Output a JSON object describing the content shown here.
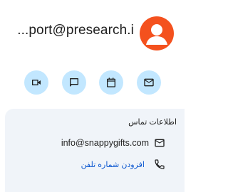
{
  "contact": {
    "display_email_truncated": "...port@presearch.i",
    "avatar_color": "#f4511e"
  },
  "actions": [
    {
      "icon": "video-call-icon"
    },
    {
      "icon": "chat-icon"
    },
    {
      "icon": "calendar-icon"
    },
    {
      "icon": "mail-icon"
    }
  ],
  "contact_card": {
    "title": "اطلاعات تماس",
    "email": "info@snappygifts.com",
    "add_phone_label": "افزودن شماره تلفن"
  },
  "colors": {
    "action_bg": "#c2e7ff",
    "card_bg": "#f0f4f9",
    "link": "#0b57d0"
  }
}
